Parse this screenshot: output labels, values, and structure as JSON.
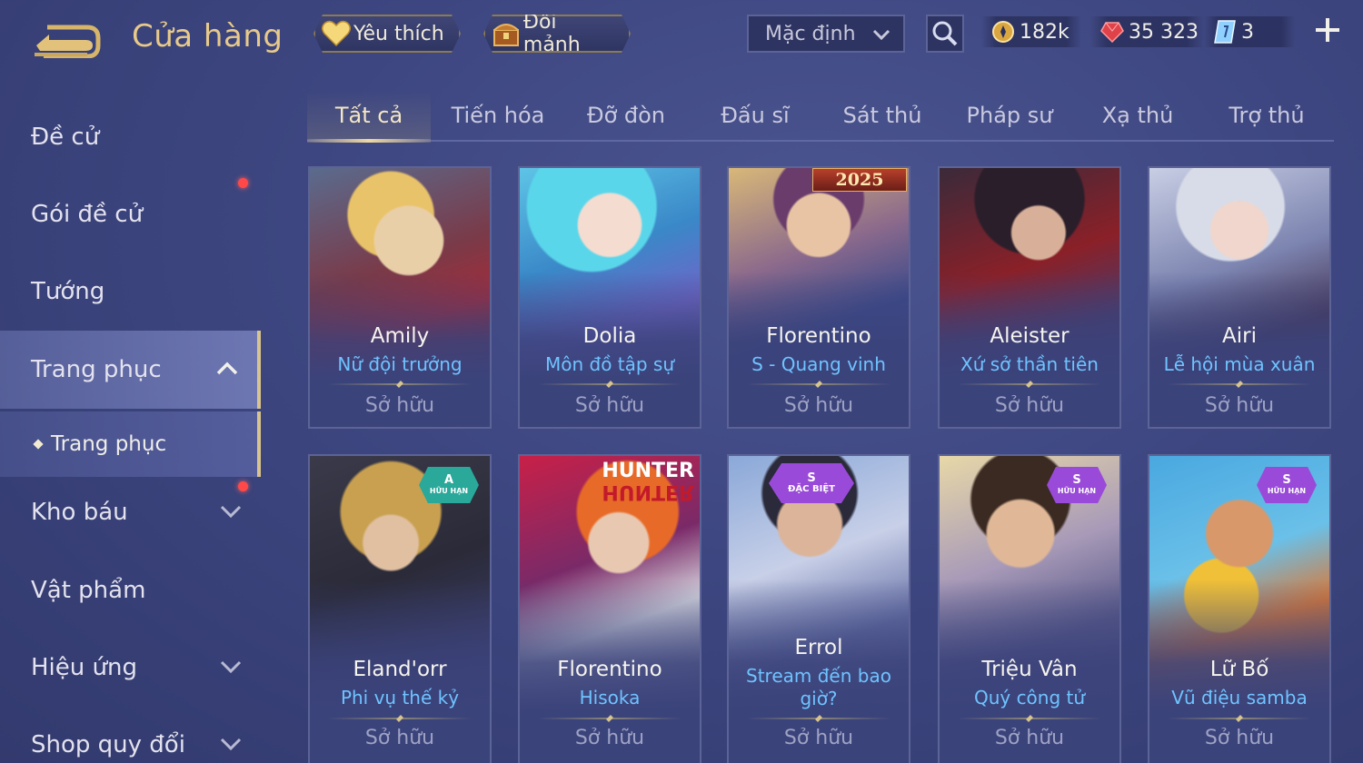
{
  "header": {
    "title": "Cửa hàng",
    "favorites_label": "Yêu thích",
    "exchange_label": "Đổi mảnh",
    "sort_value": "Mặc định",
    "currencies": [
      {
        "icon": "gold-coin-icon",
        "value": "182k"
      },
      {
        "icon": "ruby-gem-icon",
        "value": "35 323"
      },
      {
        "icon": "voucher-card-icon",
        "value": "3"
      }
    ]
  },
  "sidebar": {
    "items": [
      {
        "label": "Đề cử"
      },
      {
        "label": "Gói đề cử"
      },
      {
        "label": "Tướng"
      },
      {
        "label": "Trang phục"
      },
      {
        "label": "Kho báu"
      },
      {
        "label": "Vật phẩm"
      },
      {
        "label": "Hiệu ứng"
      },
      {
        "label": "Shop quy đổi"
      }
    ],
    "sub_item": "Trang phục"
  },
  "tabs": [
    "Tất cả",
    "Tiến hóa",
    "Đỡ đòn",
    "Đấu sĩ",
    "Sát thủ",
    "Pháp sư",
    "Xạ thủ",
    "Trợ thủ"
  ],
  "cards": [
    {
      "hero": "Amily",
      "skin": "Nữ đội trưởng",
      "status": "Sở hữu"
    },
    {
      "hero": "Dolia",
      "skin": "Môn đồ tập sự",
      "status": "Sở hữu"
    },
    {
      "hero": "Florentino",
      "skin": "S - Quang vinh",
      "status": "Sở hữu",
      "badge": "2025"
    },
    {
      "hero": "Aleister",
      "skin": "Xứ sở thần tiên",
      "status": "Sở hữu"
    },
    {
      "hero": "Airi",
      "skin": "Lễ hội mùa xuân",
      "status": "Sở hữu"
    },
    {
      "hero": "Eland'orr",
      "skin": "Phi vụ thế kỷ",
      "status": "Sở hữu",
      "badge_rank": "A",
      "badge_sub": "HỮU HẠN"
    },
    {
      "hero": "Florentino",
      "skin": "Hisoka",
      "status": "Sở hữu",
      "logo": "HUNTER"
    },
    {
      "hero": "Errol",
      "skin": "Stream đến bao giờ?",
      "status": "Sở hữu",
      "badge_rank": "S",
      "badge_sub": "ĐẶC BIỆT"
    },
    {
      "hero": "Triệu Vân",
      "skin": "Quý công tử",
      "status": "Sở hữu",
      "badge_rank": "S",
      "badge_sub": "HỮU HẠN"
    },
    {
      "hero": "Lữ Bố",
      "skin": "Vũ điệu samba",
      "status": "Sở hữu",
      "badge_rank": "S",
      "badge_sub": "HỮU HẠN"
    }
  ],
  "colors": {
    "accent_gold": "#e7c98a",
    "skin_name_blue": "#6fc3ff",
    "notification_red": "#ff4848"
  }
}
